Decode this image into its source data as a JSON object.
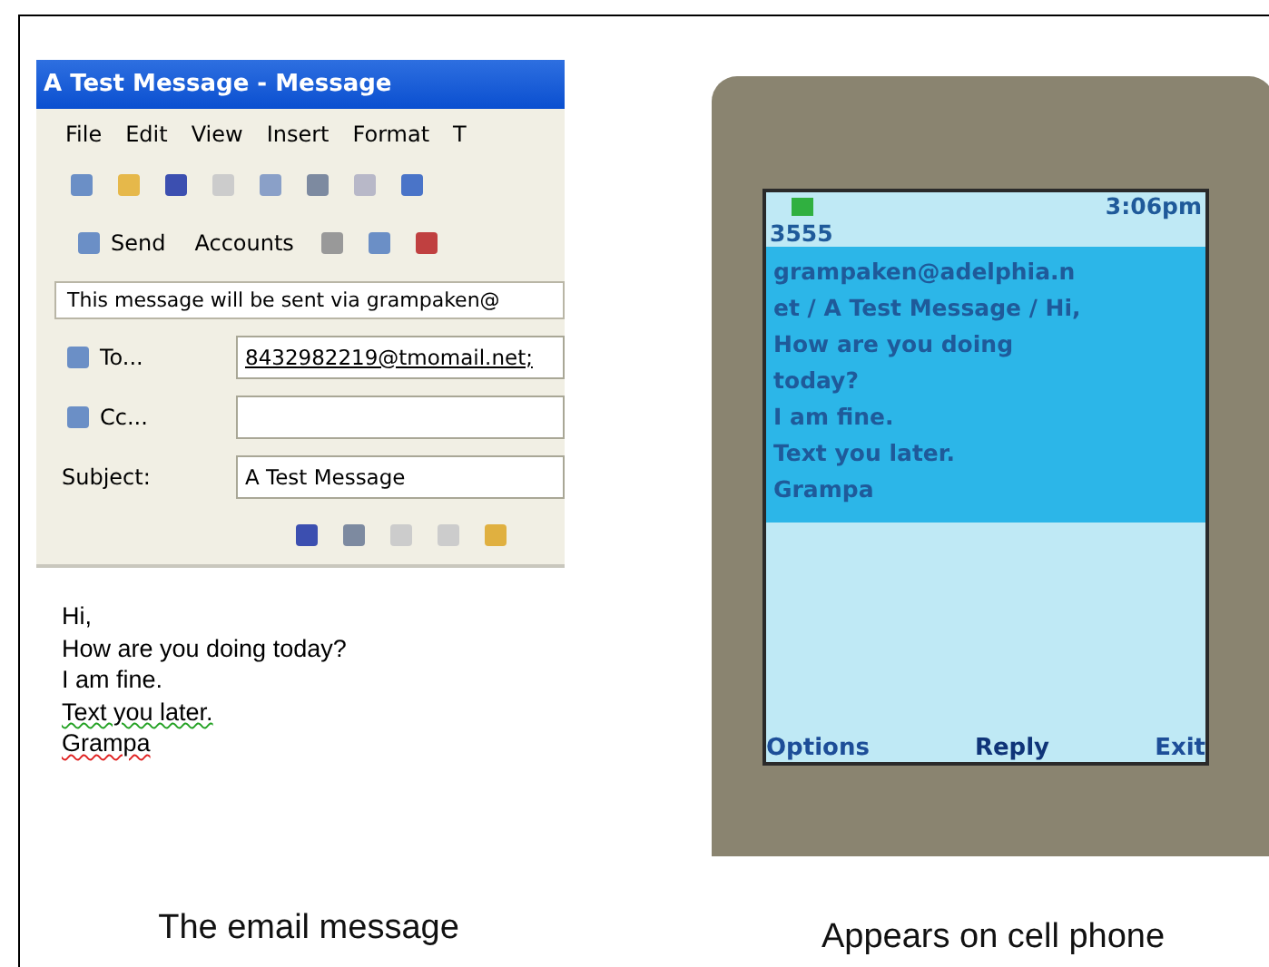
{
  "email_window": {
    "title": "A Test Message - Message",
    "menu": [
      "File",
      "Edit",
      "View",
      "Insert",
      "Format",
      "T"
    ],
    "send_button": "Send",
    "accounts_button": "Accounts",
    "info_bar": "This message will be sent via grampaken@",
    "fields": [
      {
        "kind": "address",
        "label": "To...",
        "value": "8432982219@tmomail.net;"
      },
      {
        "kind": "address",
        "label": "Cc..."
      },
      {
        "kind": "plain",
        "label": "Subject:",
        "value": "A Test Message"
      }
    ],
    "body_lines": [
      {
        "text": "Hi,",
        "grammar_error": false,
        "spelling_error": false
      },
      {
        "text": "How are you doing today?",
        "grammar_error": false,
        "spelling_error": false
      },
      {
        "text": "I am fine.",
        "grammar_error": false,
        "spelling_error": false
      },
      {
        "text": "Text you later.",
        "grammar_error": true,
        "spelling_error": false
      },
      {
        "text": "Grampa",
        "grammar_error": false,
        "spelling_error": true
      }
    ]
  },
  "phone": {
    "time": "3:06pm",
    "sender": "3555",
    "message_lines": [
      "grampaken@adelphia.n",
      "et / A Test Message / Hi,",
      "How are you doing",
      "today?",
      "I am fine.",
      "Text you later.",
      "Grampa"
    ],
    "softkeys": [
      "Options",
      "Reply",
      "Exit"
    ]
  },
  "captions": [
    "The email message",
    "Appears on cell phone"
  ]
}
